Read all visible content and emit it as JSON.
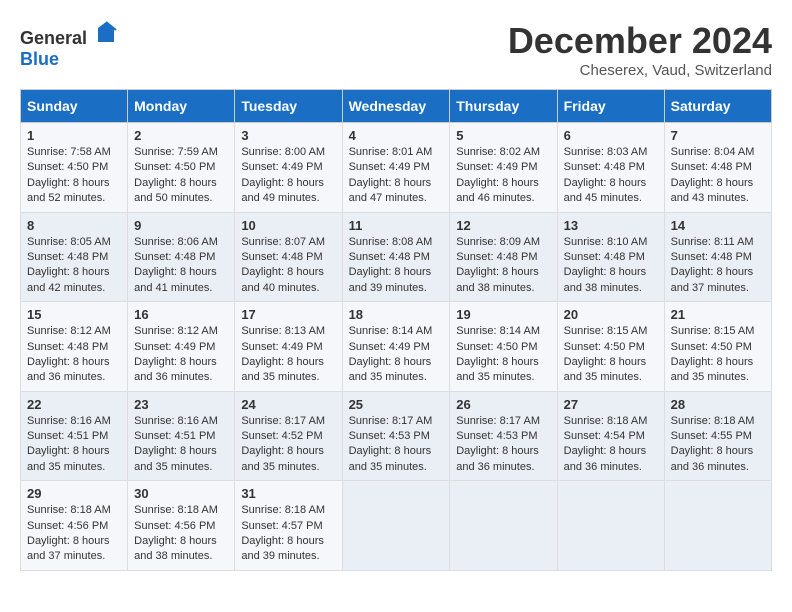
{
  "header": {
    "logo_general": "General",
    "logo_blue": "Blue",
    "month": "December 2024",
    "location": "Cheserex, Vaud, Switzerland"
  },
  "days_of_week": [
    "Sunday",
    "Monday",
    "Tuesday",
    "Wednesday",
    "Thursday",
    "Friday",
    "Saturday"
  ],
  "weeks": [
    [
      {
        "day": "1",
        "sunrise": "7:58 AM",
        "sunset": "4:50 PM",
        "daylight": "8 hours and 52 minutes."
      },
      {
        "day": "2",
        "sunrise": "7:59 AM",
        "sunset": "4:50 PM",
        "daylight": "8 hours and 50 minutes."
      },
      {
        "day": "3",
        "sunrise": "8:00 AM",
        "sunset": "4:49 PM",
        "daylight": "8 hours and 49 minutes."
      },
      {
        "day": "4",
        "sunrise": "8:01 AM",
        "sunset": "4:49 PM",
        "daylight": "8 hours and 47 minutes."
      },
      {
        "day": "5",
        "sunrise": "8:02 AM",
        "sunset": "4:49 PM",
        "daylight": "8 hours and 46 minutes."
      },
      {
        "day": "6",
        "sunrise": "8:03 AM",
        "sunset": "4:48 PM",
        "daylight": "8 hours and 45 minutes."
      },
      {
        "day": "7",
        "sunrise": "8:04 AM",
        "sunset": "4:48 PM",
        "daylight": "8 hours and 43 minutes."
      }
    ],
    [
      {
        "day": "8",
        "sunrise": "8:05 AM",
        "sunset": "4:48 PM",
        "daylight": "8 hours and 42 minutes."
      },
      {
        "day": "9",
        "sunrise": "8:06 AM",
        "sunset": "4:48 PM",
        "daylight": "8 hours and 41 minutes."
      },
      {
        "day": "10",
        "sunrise": "8:07 AM",
        "sunset": "4:48 PM",
        "daylight": "8 hours and 40 minutes."
      },
      {
        "day": "11",
        "sunrise": "8:08 AM",
        "sunset": "4:48 PM",
        "daylight": "8 hours and 39 minutes."
      },
      {
        "day": "12",
        "sunrise": "8:09 AM",
        "sunset": "4:48 PM",
        "daylight": "8 hours and 38 minutes."
      },
      {
        "day": "13",
        "sunrise": "8:10 AM",
        "sunset": "4:48 PM",
        "daylight": "8 hours and 38 minutes."
      },
      {
        "day": "14",
        "sunrise": "8:11 AM",
        "sunset": "4:48 PM",
        "daylight": "8 hours and 37 minutes."
      }
    ],
    [
      {
        "day": "15",
        "sunrise": "8:12 AM",
        "sunset": "4:48 PM",
        "daylight": "8 hours and 36 minutes."
      },
      {
        "day": "16",
        "sunrise": "8:12 AM",
        "sunset": "4:49 PM",
        "daylight": "8 hours and 36 minutes."
      },
      {
        "day": "17",
        "sunrise": "8:13 AM",
        "sunset": "4:49 PM",
        "daylight": "8 hours and 35 minutes."
      },
      {
        "day": "18",
        "sunrise": "8:14 AM",
        "sunset": "4:49 PM",
        "daylight": "8 hours and 35 minutes."
      },
      {
        "day": "19",
        "sunrise": "8:14 AM",
        "sunset": "4:50 PM",
        "daylight": "8 hours and 35 minutes."
      },
      {
        "day": "20",
        "sunrise": "8:15 AM",
        "sunset": "4:50 PM",
        "daylight": "8 hours and 35 minutes."
      },
      {
        "day": "21",
        "sunrise": "8:15 AM",
        "sunset": "4:50 PM",
        "daylight": "8 hours and 35 minutes."
      }
    ],
    [
      {
        "day": "22",
        "sunrise": "8:16 AM",
        "sunset": "4:51 PM",
        "daylight": "8 hours and 35 minutes."
      },
      {
        "day": "23",
        "sunrise": "8:16 AM",
        "sunset": "4:51 PM",
        "daylight": "8 hours and 35 minutes."
      },
      {
        "day": "24",
        "sunrise": "8:17 AM",
        "sunset": "4:52 PM",
        "daylight": "8 hours and 35 minutes."
      },
      {
        "day": "25",
        "sunrise": "8:17 AM",
        "sunset": "4:53 PM",
        "daylight": "8 hours and 35 minutes."
      },
      {
        "day": "26",
        "sunrise": "8:17 AM",
        "sunset": "4:53 PM",
        "daylight": "8 hours and 36 minutes."
      },
      {
        "day": "27",
        "sunrise": "8:18 AM",
        "sunset": "4:54 PM",
        "daylight": "8 hours and 36 minutes."
      },
      {
        "day": "28",
        "sunrise": "8:18 AM",
        "sunset": "4:55 PM",
        "daylight": "8 hours and 36 minutes."
      }
    ],
    [
      {
        "day": "29",
        "sunrise": "8:18 AM",
        "sunset": "4:56 PM",
        "daylight": "8 hours and 37 minutes."
      },
      {
        "day": "30",
        "sunrise": "8:18 AM",
        "sunset": "4:56 PM",
        "daylight": "8 hours and 38 minutes."
      },
      {
        "day": "31",
        "sunrise": "8:18 AM",
        "sunset": "4:57 PM",
        "daylight": "8 hours and 39 minutes."
      },
      null,
      null,
      null,
      null
    ]
  ]
}
